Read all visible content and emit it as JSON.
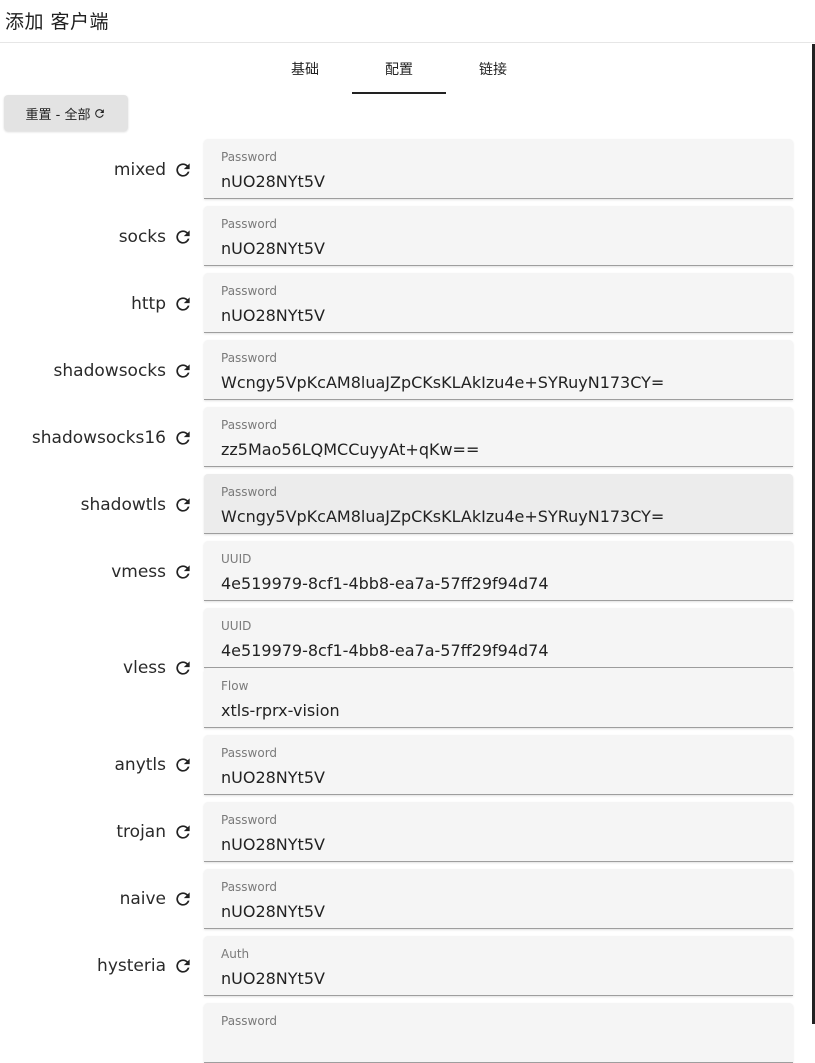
{
  "header": {
    "title": "添加 客户端"
  },
  "tabs": [
    {
      "label": "基础",
      "active": false
    },
    {
      "label": "配置",
      "active": true
    },
    {
      "label": "链接",
      "active": false
    }
  ],
  "reset_all": {
    "label": "重置 - 全部"
  },
  "rows": [
    {
      "protocol": "mixed",
      "fields": [
        {
          "label": "Password",
          "value": "nUO28NYt5V"
        }
      ]
    },
    {
      "protocol": "socks",
      "fields": [
        {
          "label": "Password",
          "value": "nUO28NYt5V"
        }
      ]
    },
    {
      "protocol": "http",
      "fields": [
        {
          "label": "Password",
          "value": "nUO28NYt5V"
        }
      ]
    },
    {
      "protocol": "shadowsocks",
      "fields": [
        {
          "label": "Password",
          "value": "Wcngy5VpKcAM8luaJZpCKsKLAkIzu4e+SYRuyN173CY="
        }
      ]
    },
    {
      "protocol": "shadowsocks16",
      "fields": [
        {
          "label": "Password",
          "value": "zz5Mao56LQMCCuyyAt+qKw=="
        }
      ]
    },
    {
      "protocol": "shadowtls",
      "fields": [
        {
          "label": "Password",
          "value": "Wcngy5VpKcAM8luaJZpCKsKLAkIzu4e+SYRuyN173CY="
        }
      ]
    },
    {
      "protocol": "vmess",
      "fields": [
        {
          "label": "UUID",
          "value": "4e519979-8cf1-4bb8-ea7a-57ff29f94d74"
        }
      ]
    },
    {
      "protocol": "vless",
      "fields": [
        {
          "label": "UUID",
          "value": "4e519979-8cf1-4bb8-ea7a-57ff29f94d74"
        },
        {
          "label": "Flow",
          "value": "xtls-rprx-vision"
        }
      ]
    },
    {
      "protocol": "anytls",
      "fields": [
        {
          "label": "Password",
          "value": "nUO28NYt5V"
        }
      ]
    },
    {
      "protocol": "trojan",
      "fields": [
        {
          "label": "Password",
          "value": "nUO28NYt5V"
        }
      ]
    },
    {
      "protocol": "naive",
      "fields": [
        {
          "label": "Password",
          "value": "nUO28NYt5V"
        }
      ]
    },
    {
      "protocol": "hysteria",
      "fields": [
        {
          "label": "Auth",
          "value": "nUO28NYt5V"
        }
      ]
    },
    {
      "protocol": "",
      "fields": [
        {
          "label": "Password",
          "value": ""
        }
      ]
    }
  ],
  "icons": {
    "reload": "reload-icon"
  },
  "colors": {
    "field_bg": "#f5f5f5",
    "field_hover_bg": "#ececec",
    "button_bg": "#e3e3e3"
  }
}
